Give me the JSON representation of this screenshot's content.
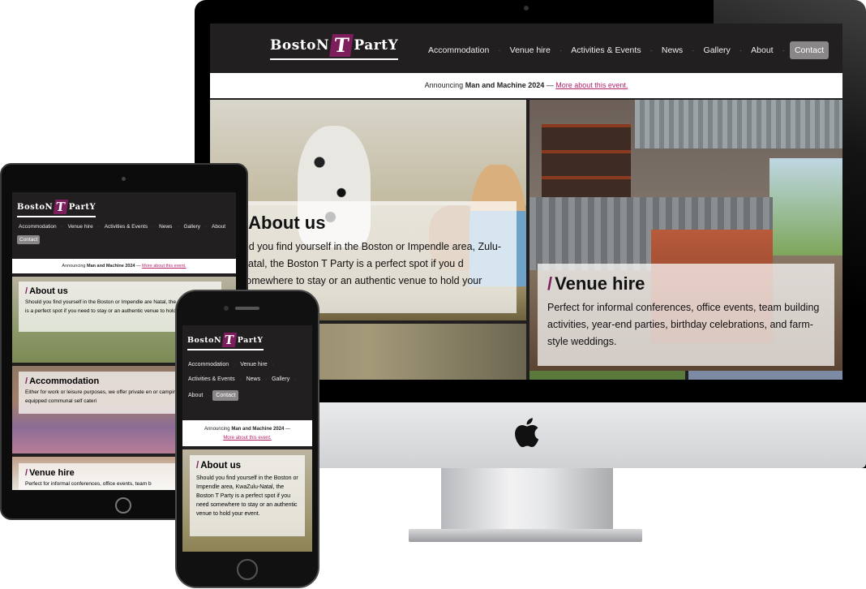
{
  "brand": {
    "logo_left": "BostoN",
    "logo_t": "T",
    "logo_right": "PartY"
  },
  "nav": {
    "items": [
      "Accommodation",
      "Venue hire",
      "Activities & Events",
      "News",
      "Gallery",
      "About"
    ],
    "contact": "Contact"
  },
  "announcement": {
    "prefix": "Announcing",
    "event": "Man and Machine 2024",
    "dash": "—",
    "link": "More about this event."
  },
  "sections": {
    "about": {
      "title": "About us",
      "slash": "/",
      "body_desktop": "uld you find yourself in the Boston or Impendle area, Zulu-Natal, the Boston T Party is a perfect spot if you d somewhere to stay or an authentic venue to hold your",
      "body_tablet": "Should you find yourself in the Boston or Impendle are Natal, the Boston T Party is a perfect spot if you need to stay or an authentic venue to hold your event.",
      "body_phone": "Should you find yourself in the Boston or Impendle area, KwaZulu-Natal, the Boston T Party is a perfect spot if you need somewhere to stay or an authentic venue to hold your event."
    },
    "accommodation": {
      "title": "Accommodation",
      "slash": "/",
      "body_tablet": "Either for work or leisure purposes, we offer private en or camping with 2 fully equipped communal self cateri"
    },
    "venue": {
      "title": "Venue hire",
      "slash": "/",
      "body_desktop": "Perfect for informal conferences, office events, team building activities, year-end parties, birthday celebrations, and farm-style weddings.",
      "body_tablet": "Perfect for informal conferences, office events, team b"
    }
  },
  "colors": {
    "header_bg": "#221f20",
    "accent": "#7d1e5c",
    "link": "#b3236c",
    "contact_bg": "#8a8788"
  },
  "icons": {
    "apple": "apple-logo-icon"
  }
}
